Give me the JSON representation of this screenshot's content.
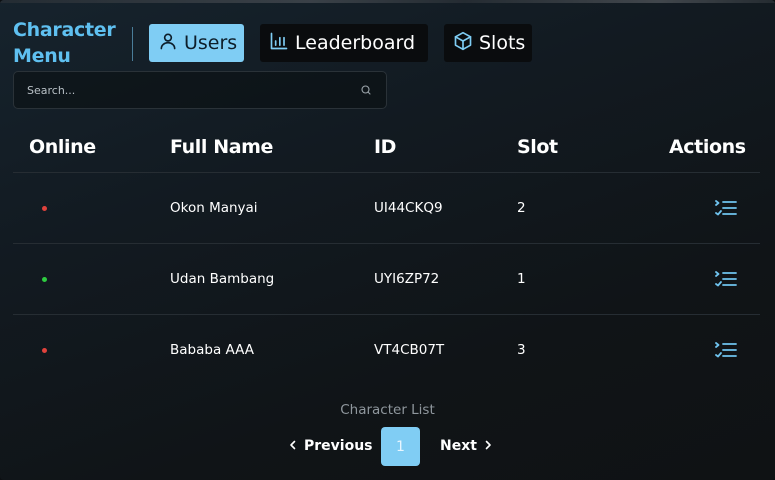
{
  "brand": {
    "title": "Character Menu"
  },
  "tabs": [
    {
      "label": "Users",
      "icon": "user-icon",
      "active": true
    },
    {
      "label": "Leaderboard",
      "icon": "bar-chart-icon",
      "active": false
    },
    {
      "label": "Slots",
      "icon": "cube-icon",
      "active": false
    }
  ],
  "search": {
    "placeholder": "Search...",
    "value": ""
  },
  "table": {
    "headers": [
      "Online",
      "Full Name",
      "ID",
      "Slot",
      "Actions"
    ],
    "rows": [
      {
        "online": false,
        "full_name": "Okon Manyai",
        "id": "UI44CKQ9",
        "slot": "2",
        "action_icon": "list-icon"
      },
      {
        "online": true,
        "full_name": "Udan Bambang",
        "id": "UYI6ZP72",
        "slot": "1",
        "action_icon": "list-icon"
      },
      {
        "online": false,
        "full_name": "Bababa AAA",
        "id": "VT4CB07T",
        "slot": "3",
        "action_icon": "list-icon"
      }
    ]
  },
  "footer": {
    "label": "Character List",
    "previous_label": "Previous",
    "next_label": "Next",
    "current_page": "1"
  },
  "colors": {
    "accent": "#7fcdf4",
    "brand": "#5fc0f0",
    "online": "#2ecc40",
    "offline": "#e0423c",
    "action_icon": "#6fc3ee"
  }
}
